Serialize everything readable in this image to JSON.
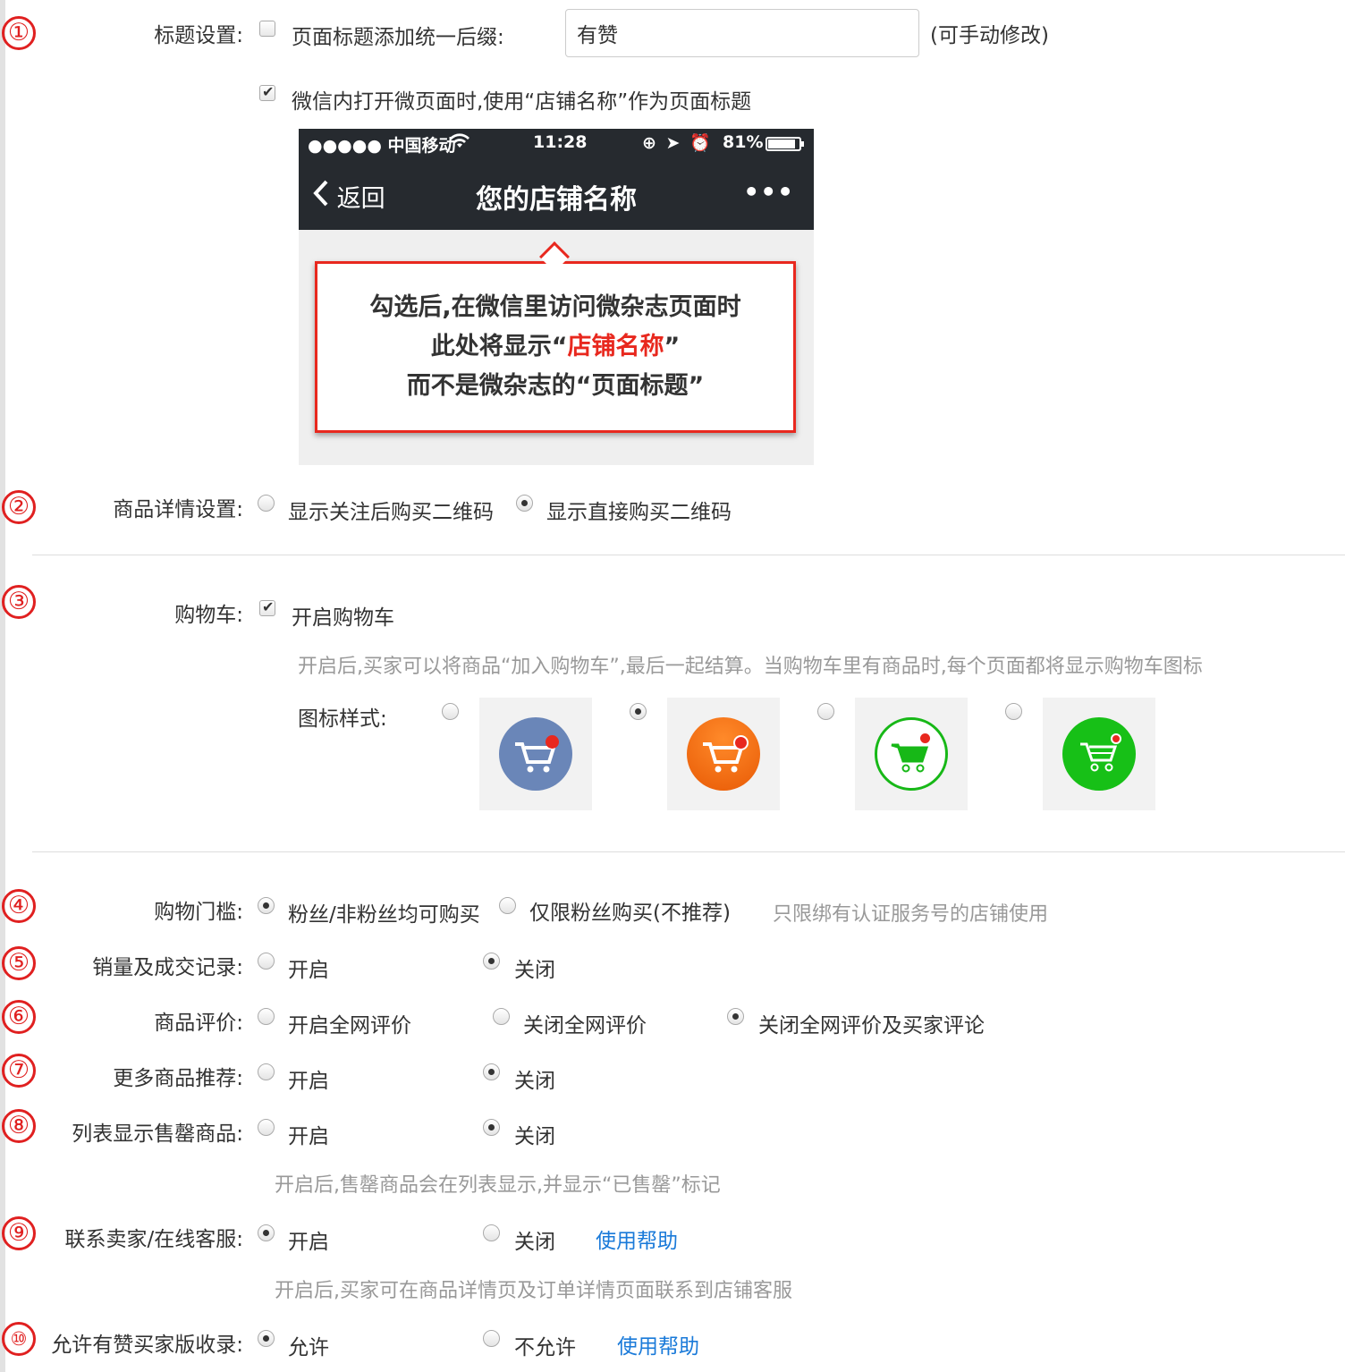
{
  "title_settings": {
    "label": "标题设置:",
    "suffix_label": "页面标题添加统一后缀:",
    "suffix_value": "有赞",
    "suffix_note": "(可手动修改)",
    "wechat_option": "微信内打开微页面时,使用“店铺名称”作为页面标题",
    "suffix_checked": false,
    "wechat_checked": true
  },
  "preview": {
    "carrier": "●●●●● 中国移动",
    "time": "11:28",
    "battery": "81%",
    "back": "返回",
    "title": "您的店铺名称",
    "more": "•••",
    "callout_line1": "勾选后,在微信里访问微杂志页面时",
    "callout_line2_pre": "此处将显示“",
    "callout_line2_red": "店铺名称",
    "callout_line2_post": "”",
    "callout_line3": "而不是微杂志的“页面标题”"
  },
  "product_detail": {
    "label": "商品详情设置:",
    "options": [
      "显示关注后购买二维码",
      "显示直接购买二维码"
    ],
    "selected": 1
  },
  "cart": {
    "label": "购物车:",
    "enable_label": "开启购物车",
    "enabled": true,
    "hint": "开启后,买家可以将商品“加入购物车”,最后一起结算。当购物车里有商品时,每个页面都将显示购物车图标",
    "icon_style_label": "图标样式:",
    "icon_selected": 1,
    "icons": [
      "cart-icon-blue",
      "cart-icon-orange",
      "cart-icon-green-outline",
      "cart-icon-green-filled"
    ],
    "colors": {
      "blue": "#6a86b8",
      "orange": "#f26a12",
      "green": "#17b817",
      "red": "#e8281e"
    }
  },
  "threshold": {
    "label": "购物门槛:",
    "options": [
      "粉丝/非粉丝均可购买",
      "仅限粉丝购买(不推荐)"
    ],
    "note": "只限绑有认证服务号的店铺使用",
    "selected": 0
  },
  "sales_record": {
    "label": "销量及成交记录:",
    "options": [
      "开启",
      "关闭"
    ],
    "selected": 1
  },
  "review": {
    "label": "商品评价:",
    "options": [
      "开启全网评价",
      "关闭全网评价",
      "关闭全网评价及买家评论"
    ],
    "selected": 2
  },
  "recommend": {
    "label": "更多商品推荐:",
    "options": [
      "开启",
      "关闭"
    ],
    "selected": 1
  },
  "soldout": {
    "label": "列表显示售罄商品:",
    "options": [
      "开启",
      "关闭"
    ],
    "selected": 1,
    "hint": "开启后,售罄商品会在列表显示,并显示“已售罄”标记"
  },
  "contact": {
    "label": "联系卖家/在线客服:",
    "options": [
      "开启",
      "关闭"
    ],
    "selected": 0,
    "help": "使用帮助",
    "hint": "开启后,买家可在商品详情页及订单详情页面联系到店铺客服"
  },
  "collect": {
    "label": "允许有赞买家版收录:",
    "options": [
      "允许",
      "不允许"
    ],
    "selected": 0,
    "help": "使用帮助"
  },
  "markers": [
    "①",
    "②",
    "③",
    "④",
    "⑤",
    "⑥",
    "⑦",
    "⑧",
    "⑨",
    "⑩"
  ]
}
